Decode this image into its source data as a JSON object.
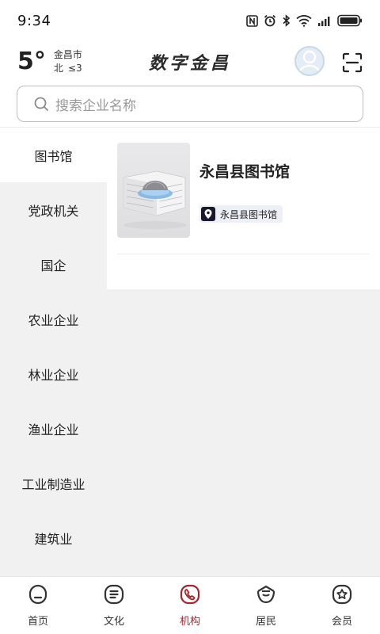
{
  "status_bar": {
    "time": "9:34",
    "icons": [
      "nfc-icon",
      "alarm-icon",
      "bluetooth-icon",
      "wifi-icon",
      "signal-icon",
      "battery-icon"
    ]
  },
  "header": {
    "temperature": "5°",
    "city": "金昌市",
    "wind_direction": "北",
    "wind_level": "≤3",
    "app_title": "数字金昌"
  },
  "search": {
    "placeholder": "搜索企业名称"
  },
  "sidebar": {
    "active_index": 0,
    "items": [
      {
        "label": "图书馆"
      },
      {
        "label": "党政机关"
      },
      {
        "label": "国企"
      },
      {
        "label": "农业企业"
      },
      {
        "label": "林业企业"
      },
      {
        "label": "渔业企业"
      },
      {
        "label": "工业制造业"
      },
      {
        "label": "建筑业"
      }
    ]
  },
  "content": {
    "items": [
      {
        "name": "永昌县图书馆",
        "tag": "永昌县图书馆"
      }
    ]
  },
  "tabbar": {
    "active_index": 2,
    "accent_color": "#a3262c",
    "tabs": [
      {
        "label": "首页",
        "icon": "home-icon"
      },
      {
        "label": "文化",
        "icon": "culture-icon"
      },
      {
        "label": "机构",
        "icon": "institution-icon"
      },
      {
        "label": "居民",
        "icon": "residents-icon"
      },
      {
        "label": "会员",
        "icon": "member-icon"
      }
    ]
  }
}
